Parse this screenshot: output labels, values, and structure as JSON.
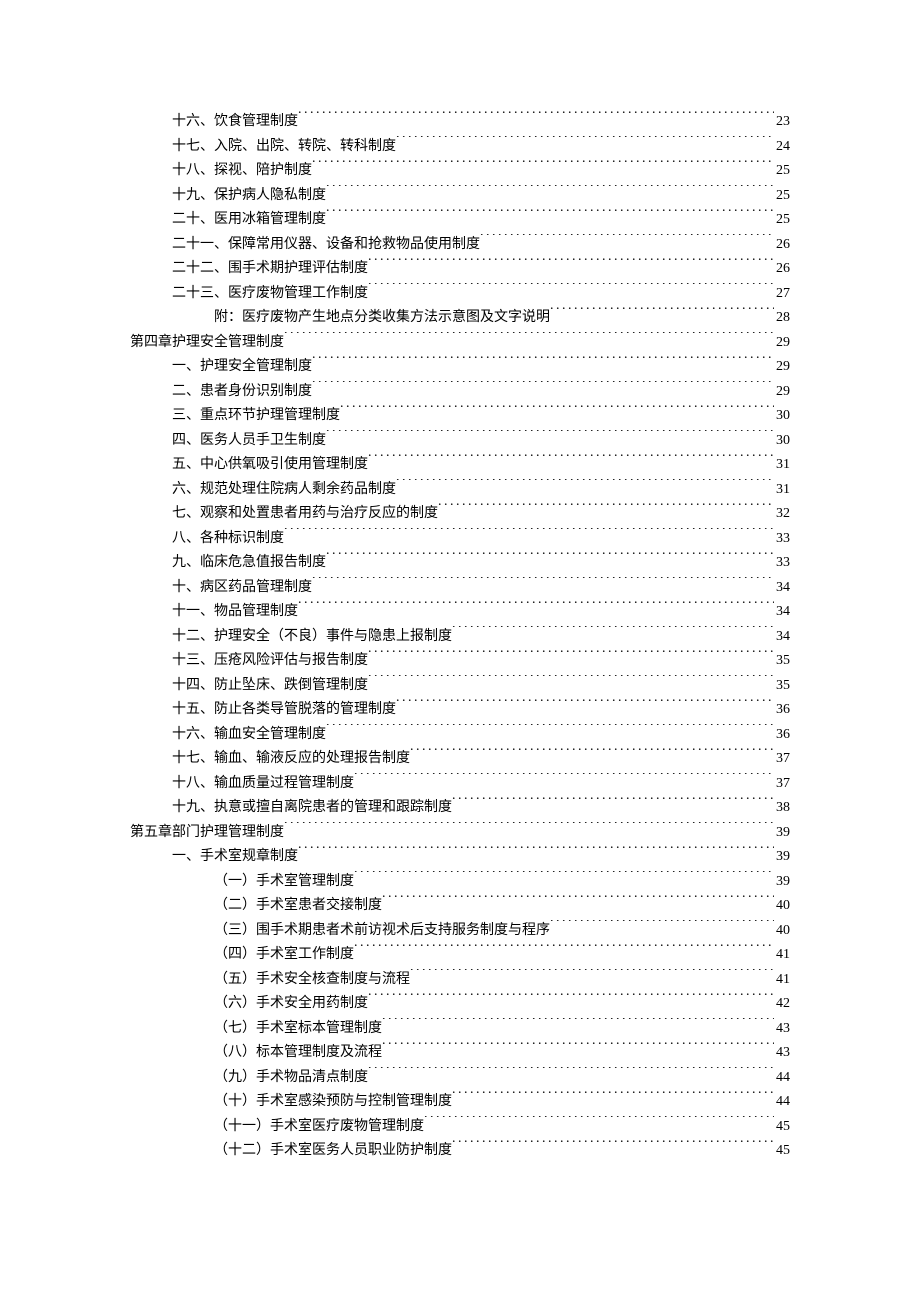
{
  "toc": [
    {
      "level": 2,
      "title": "十六、饮食管理制度",
      "page": "23"
    },
    {
      "level": 2,
      "title": "十七、入院、出院、转院、转科制度",
      "page": "24"
    },
    {
      "level": 2,
      "title": "十八、探视、陪护制度",
      "page": "25"
    },
    {
      "level": 2,
      "title": "十九、保护病人隐私制度",
      "page": "25"
    },
    {
      "level": 2,
      "title": "二十、医用冰箱管理制度",
      "page": "25"
    },
    {
      "level": 2,
      "title": "二十一、保障常用仪器、设备和抢救物品使用制度",
      "page": "26"
    },
    {
      "level": 2,
      "title": "二十二、围手术期护理评估制度",
      "page": "26"
    },
    {
      "level": 2,
      "title": "二十三、医疗废物管理工作制度",
      "page": "27"
    },
    {
      "level": 3,
      "title": "附：医疗废物产生地点分类收集方法示意图及文字说明",
      "page": "28"
    },
    {
      "level": 1,
      "title": "第四章护理安全管理制度",
      "page": "29"
    },
    {
      "level": 2,
      "title": "一、护理安全管理制度",
      "page": "29"
    },
    {
      "level": 2,
      "title": "二、患者身份识别制度",
      "page": "29"
    },
    {
      "level": 2,
      "title": "三、重点环节护理管理制度",
      "page": "30"
    },
    {
      "level": 2,
      "title": "四、医务人员手卫生制度",
      "page": "30"
    },
    {
      "level": 2,
      "title": "五、中心供氧吸引使用管理制度",
      "page": "31"
    },
    {
      "level": 2,
      "title": "六、规范处理住院病人剩余药品制度",
      "page": "31"
    },
    {
      "level": 2,
      "title": "七、观察和处置患者用药与治疗反应的制度",
      "page": "32"
    },
    {
      "level": 2,
      "title": "八、各种标识制度",
      "page": "33"
    },
    {
      "level": 2,
      "title": "九、临床危急值报告制度",
      "page": "33"
    },
    {
      "level": 2,
      "title": "十、病区药品管理制度",
      "page": "34"
    },
    {
      "level": 2,
      "title": "十一、物品管理制度",
      "page": "34"
    },
    {
      "level": 2,
      "title": "十二、护理安全（不良）事件与隐患上报制度",
      "page": "34"
    },
    {
      "level": 2,
      "title": "十三、压疮风险评估与报告制度",
      "page": "35"
    },
    {
      "level": 2,
      "title": "十四、防止坠床、跌倒管理制度",
      "page": "35"
    },
    {
      "level": 2,
      "title": "十五、防止各类导管脱落的管理制度",
      "page": "36"
    },
    {
      "level": 2,
      "title": "十六、输血安全管理制度",
      "page": "36"
    },
    {
      "level": 2,
      "title": "十七、输血、输液反应的处理报告制度",
      "page": "37"
    },
    {
      "level": 2,
      "title": "十八、输血质量过程管理制度",
      "page": "37"
    },
    {
      "level": 2,
      "title": "十九、执意或擅自离院患者的管理和跟踪制度",
      "page": "38"
    },
    {
      "level": 1,
      "title": "第五章部门护理管理制度",
      "page": "39"
    },
    {
      "level": 2,
      "title": "一、手术室规章制度",
      "page": "39"
    },
    {
      "level": 3,
      "title": "（一）手术室管理制度",
      "page": "39"
    },
    {
      "level": 3,
      "title": "（二）手术室患者交接制度",
      "page": "40"
    },
    {
      "level": 3,
      "title": "（三）围手术期患者术前访视术后支持服务制度与程序",
      "page": "40"
    },
    {
      "level": 3,
      "title": "（四）手术室工作制度",
      "page": "41"
    },
    {
      "level": 3,
      "title": "（五）手术安全核查制度与流程",
      "page": "41"
    },
    {
      "level": 3,
      "title": "（六）手术安全用药制度",
      "page": "42"
    },
    {
      "level": 3,
      "title": "（七）手术室标本管理制度",
      "page": "43"
    },
    {
      "level": 3,
      "title": "（八）标本管理制度及流程",
      "page": "43"
    },
    {
      "level": 3,
      "title": "（九）手术物品清点制度",
      "page": "44"
    },
    {
      "level": 3,
      "title": "（十）手术室感染预防与控制管理制度",
      "page": "44"
    },
    {
      "level": 3,
      "title": "（十一）手术室医疗废物管理制度",
      "page": "45"
    },
    {
      "level": 3,
      "title": "（十二）手术室医务人员职业防护制度",
      "page": "45"
    }
  ]
}
